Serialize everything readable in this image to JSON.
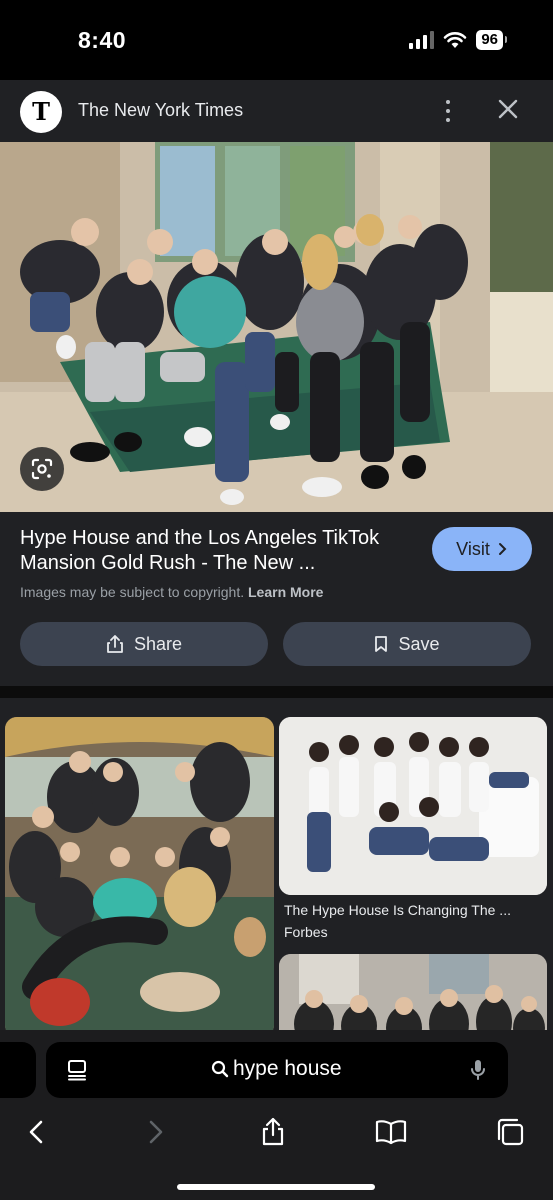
{
  "status_bar": {
    "time": "8:40",
    "battery": "96"
  },
  "header": {
    "source_name": "The New York Times",
    "logo_glyph": "T"
  },
  "result": {
    "title": "Hype House and the Los Angeles TikTok Mansion Gold Rush - The New ...",
    "visit_label": "Visit",
    "copyright_text": "Images may be subject to copyright.",
    "learn_more": "Learn More",
    "share_label": "Share",
    "save_label": "Save"
  },
  "related": [
    {
      "caption": "The Hype House Is Changing The ...",
      "source": "Forbes"
    }
  ],
  "address_bar": {
    "query": "hype house"
  },
  "colors": {
    "accent": "#8ab4f8",
    "panel": "#202124",
    "button": "#3c4350"
  }
}
